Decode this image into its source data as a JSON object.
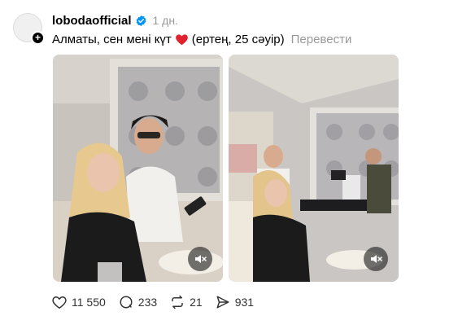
{
  "post": {
    "username": "lobodaofficial",
    "time": "1 дн.",
    "caption_before": "Алматы, сен мені күт",
    "caption_after": "(ертең, 25 сәуір)",
    "translate_label": "Перевести"
  },
  "icons": {
    "verified": "verified-badge-icon",
    "heart": "red-heart-emoji-icon",
    "mute": "speaker-muted-icon",
    "like": "heart-icon",
    "comment": "comment-icon",
    "repost": "repost-icon",
    "share": "share-icon"
  },
  "colors": {
    "verified": "#0095f6",
    "heart": "#e0212e",
    "secondary_text": "#999999"
  },
  "actions": {
    "likes": "11 550",
    "comments": "233",
    "reposts": "21",
    "shares": "931"
  }
}
